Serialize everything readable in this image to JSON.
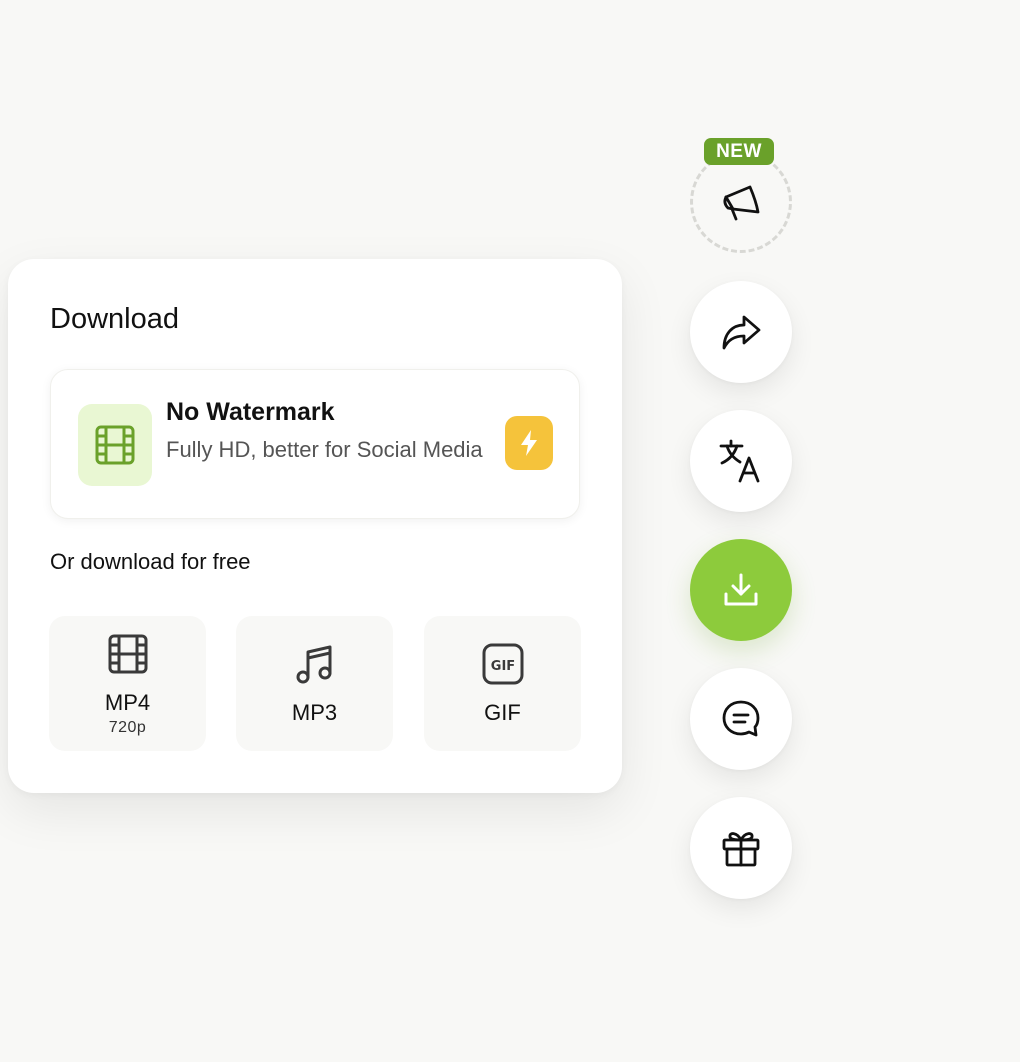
{
  "download_panel": {
    "title": "Download",
    "premium_option": {
      "title": "No Watermark",
      "subtitle": "Fully HD, better for Social Media",
      "icon": "film-icon",
      "badge_icon": "lightning-icon"
    },
    "free_label": "Or download for free",
    "formats": [
      {
        "label": "MP4",
        "sub": "720p",
        "icon": "film-icon"
      },
      {
        "label": "MP3",
        "sub": "",
        "icon": "music-note-icon"
      },
      {
        "label": "GIF",
        "sub": "",
        "icon": "gif-icon"
      }
    ]
  },
  "side_rail": {
    "new_badge": "NEW",
    "buttons": [
      {
        "name": "announcements",
        "icon": "megaphone-icon"
      },
      {
        "name": "share",
        "icon": "share-arrow-icon"
      },
      {
        "name": "translate",
        "icon": "translate-icon"
      },
      {
        "name": "download",
        "icon": "download-icon",
        "active": true
      },
      {
        "name": "comments",
        "icon": "chat-bubble-icon"
      },
      {
        "name": "gifts",
        "icon": "gift-icon"
      }
    ]
  },
  "colors": {
    "accent_green": "#8dcb3c",
    "badge_green": "#6aa12a",
    "premium_icon_bg": "#e9f7d3",
    "bolt_yellow": "#f5c33b",
    "background": "#f8f8f6"
  }
}
